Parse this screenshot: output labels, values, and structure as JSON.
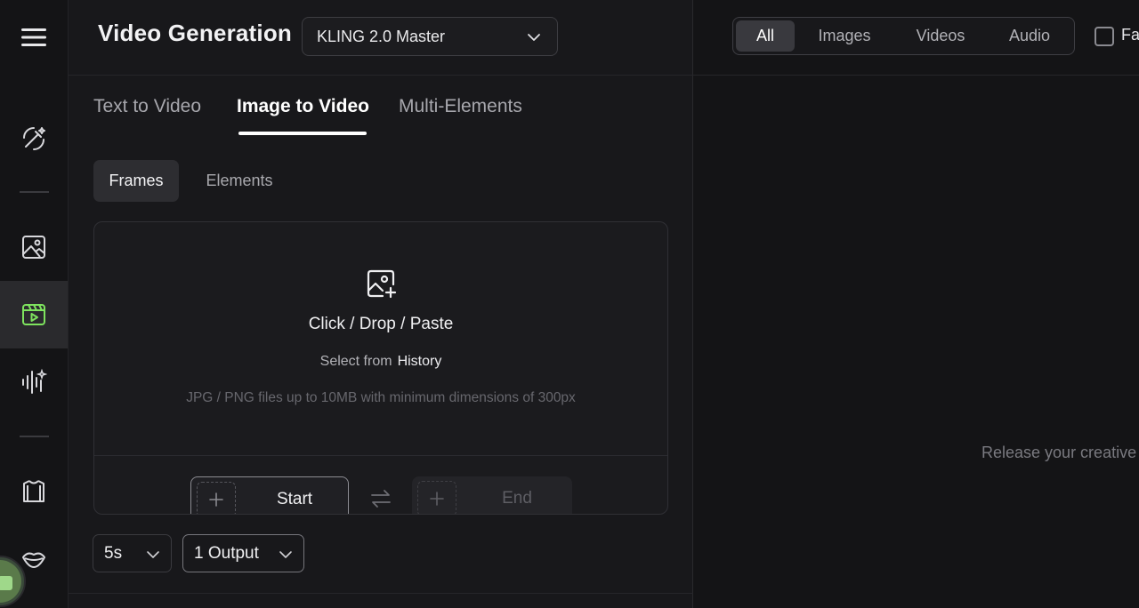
{
  "header": {
    "title": "Video Generation",
    "model_select": {
      "value": "KLING 2.0 Master"
    }
  },
  "mode_tabs": [
    {
      "label": "Text to Video",
      "active": false
    },
    {
      "label": "Image to Video",
      "active": true
    },
    {
      "label": "Multi-Elements",
      "active": false
    }
  ],
  "sub_tabs": [
    {
      "label": "Frames",
      "active": true
    },
    {
      "label": "Elements",
      "active": false
    }
  ],
  "upload": {
    "title": "Click / Drop / Paste",
    "select_from": "Select from",
    "history_link": "History",
    "hint": "JPG / PNG files up to 10MB with minimum dimensions of 300px"
  },
  "frames": {
    "start_label": "Start",
    "end_label": "End"
  },
  "settings": {
    "duration": "5s",
    "outputs": "1 Output"
  },
  "sidebar": {
    "items": [
      {
        "icon": "magic-wand-icon",
        "active": false
      },
      {
        "icon": "image-icon",
        "active": false
      },
      {
        "icon": "video-icon",
        "active": true
      },
      {
        "icon": "audio-icon",
        "active": false
      },
      {
        "icon": "shirt-icon",
        "active": false
      },
      {
        "icon": "lips-icon",
        "active": false
      }
    ],
    "active_color": "#7ee35e"
  },
  "gallery": {
    "filters": [
      {
        "label": "All",
        "active": true
      },
      {
        "label": "Images",
        "active": false
      },
      {
        "label": "Videos",
        "active": false
      },
      {
        "label": "Audio",
        "active": false
      }
    ],
    "favorites_label": "Fa",
    "empty_text": "Release your creative"
  }
}
